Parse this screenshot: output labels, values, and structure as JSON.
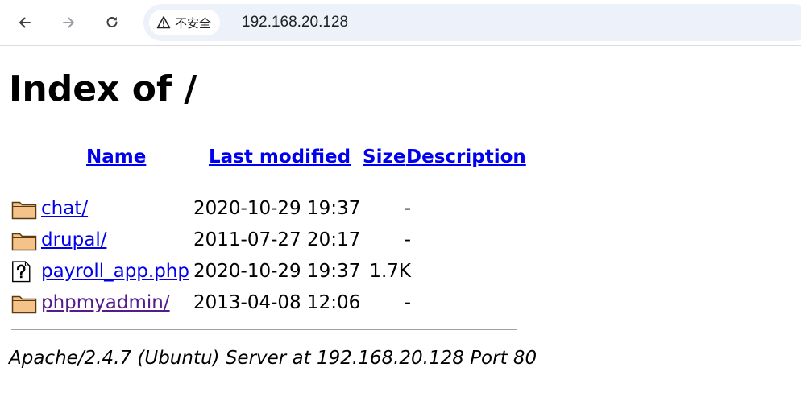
{
  "browser": {
    "security_label": "不安全",
    "url": "192.168.20.128"
  },
  "page": {
    "title": "Index of /",
    "columns": {
      "name": "Name",
      "last_modified": "Last modified",
      "size": "Size",
      "description": "Description"
    },
    "entries": [
      {
        "name": "chat/",
        "modified": "2020-10-29 19:37",
        "size": "-",
        "icon": "folder-icon",
        "visited": false
      },
      {
        "name": "drupal/",
        "modified": "2011-07-27 20:17",
        "size": "-",
        "icon": "folder-icon",
        "visited": false
      },
      {
        "name": "payroll_app.php",
        "modified": "2020-10-29 19:37",
        "size": "1.7K",
        "icon": "unknown-file-icon",
        "visited": false
      },
      {
        "name": "phpmyadmin/",
        "modified": "2013-04-08 12:06",
        "size": "-",
        "icon": "folder-icon",
        "visited": true
      }
    ],
    "footer": "Apache/2.4.7 (Ubuntu) Server at 192.168.20.128 Port 80"
  },
  "colors": {
    "link": "#0000ee",
    "visited_link": "#551a8b",
    "omnibox_bg": "#edf2fa"
  }
}
